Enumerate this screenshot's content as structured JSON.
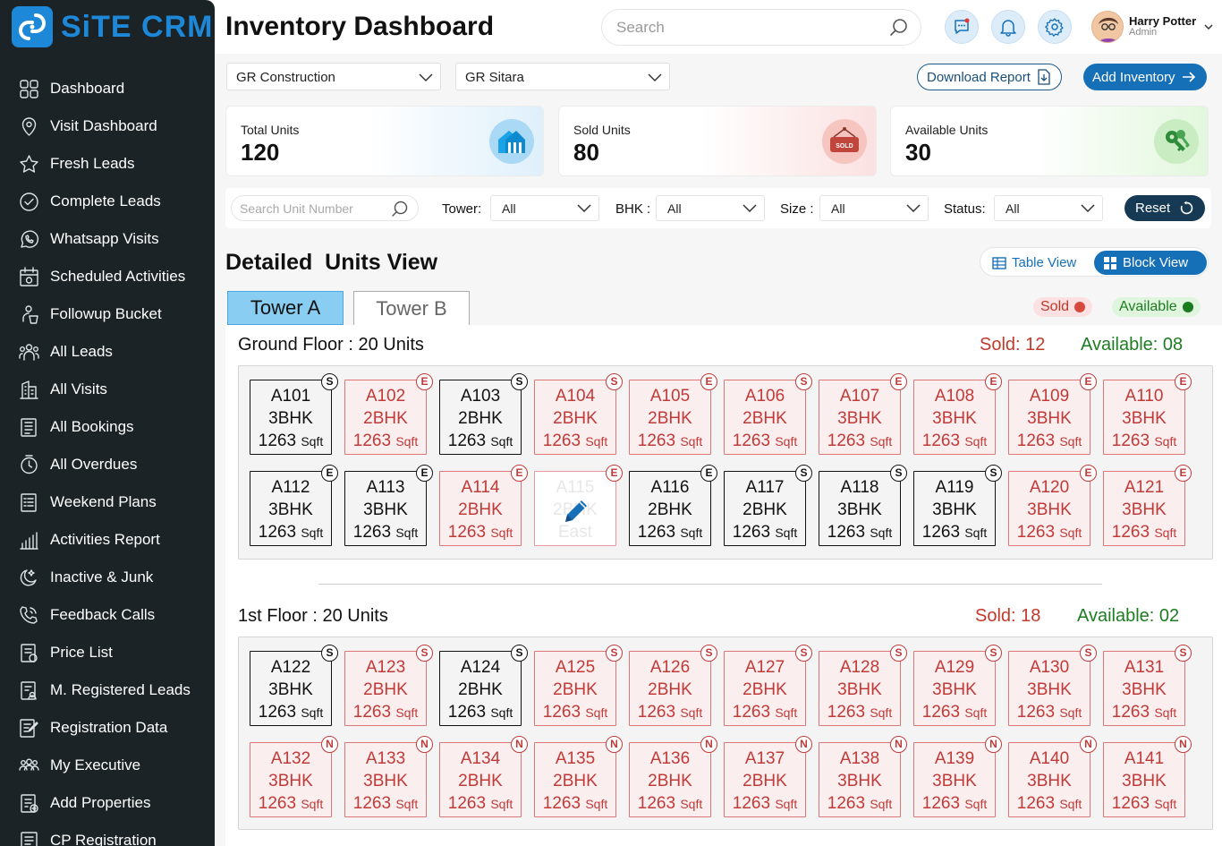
{
  "app": {
    "name": "SiTE CRM"
  },
  "sidebar": {
    "items": [
      {
        "label": "Dashboard",
        "icon": "grid-icon"
      },
      {
        "label": "Visit Dashboard",
        "icon": "location-icon"
      },
      {
        "label": "Fresh Leads",
        "icon": "star-icon"
      },
      {
        "label": "Complete Leads",
        "icon": "check-circle-icon"
      },
      {
        "label": "Whatsapp Visits",
        "icon": "whatsapp-icon"
      },
      {
        "label": "Scheduled Activities",
        "icon": "calendar-icon"
      },
      {
        "label": "Followup Bucket",
        "icon": "bucket-icon"
      },
      {
        "label": "All Leads",
        "icon": "people-icon"
      },
      {
        "label": "All Visits",
        "icon": "building-icon"
      },
      {
        "label": "All Bookings",
        "icon": "book-icon"
      },
      {
        "label": "All Overdues",
        "icon": "clock-icon"
      },
      {
        "label": "Weekend Plans",
        "icon": "list-icon"
      },
      {
        "label": "Activities Report",
        "icon": "bar-chart-icon"
      },
      {
        "label": "Inactive & Junk",
        "icon": "moon-icon"
      },
      {
        "label": "Feedback Calls",
        "icon": "phone-icon"
      },
      {
        "label": "Price List",
        "icon": "price-list-icon"
      },
      {
        "label": "M. Registered Leads",
        "icon": "register-icon"
      },
      {
        "label": "Registration Data",
        "icon": "edit-doc-icon"
      },
      {
        "label": "My Executive",
        "icon": "team-icon"
      },
      {
        "label": "Add Properties",
        "icon": "add-doc-icon"
      },
      {
        "label": "CP Registration",
        "icon": "document-icon"
      }
    ]
  },
  "header": {
    "title": "Inventory Dashboard",
    "search_placeholder": "Search",
    "user": {
      "name": "Harry Potter",
      "role": "Admin"
    }
  },
  "toolbar": {
    "company": "GR Construction",
    "project": "GR Sitara",
    "download_label": "Download Report",
    "add_label": "Add Inventory"
  },
  "stats": {
    "total": {
      "label": "Total Units",
      "value": "120"
    },
    "sold": {
      "label": "Sold Units",
      "value": "80",
      "sign": "SOLD"
    },
    "available": {
      "label": "Available Units",
      "value": "30"
    }
  },
  "filters": {
    "unit_placeholder": "Search Unit Number",
    "tower_label": "Tower:",
    "tower_value": "All",
    "bhk_label": "BHK :",
    "bhk_value": "All",
    "size_label": "Size :",
    "size_value": "All",
    "status_label": "Status:",
    "status_value": "All",
    "reset_label": "Reset"
  },
  "units_view": {
    "title": "Detailed  Units View",
    "table_view_label": "Table View",
    "block_view_label": "Block View"
  },
  "tabs": [
    "Tower A",
    "Tower B"
  ],
  "legend": {
    "sold": "Sold",
    "available": "Available"
  },
  "colors": {
    "sidebar": "#1b2326",
    "brand": "#1e88d8",
    "sold": "#c0392b",
    "available": "#1e7d22"
  },
  "floors": [
    {
      "title": "Ground Floor : 20 Units",
      "sold": "Sold: 12",
      "available": "Available: 08",
      "units": [
        {
          "id": "A101",
          "bhk": "3BHK",
          "size": "1263",
          "unit": "Sqft",
          "badge": "S",
          "status": "available"
        },
        {
          "id": "A102",
          "bhk": "2BHK",
          "size": "1263",
          "unit": "Sqft",
          "badge": "E",
          "status": "sold"
        },
        {
          "id": "A103",
          "bhk": "2BHK",
          "size": "1263",
          "unit": "Sqft",
          "badge": "S",
          "status": "available"
        },
        {
          "id": "A104",
          "bhk": "2BHK",
          "size": "1263",
          "unit": "Sqft",
          "badge": "S",
          "status": "sold"
        },
        {
          "id": "A105",
          "bhk": "2BHK",
          "size": "1263",
          "unit": "Sqft",
          "badge": "E",
          "status": "sold"
        },
        {
          "id": "A106",
          "bhk": "2BHK",
          "size": "1263",
          "unit": "Sqft",
          "badge": "S",
          "status": "sold"
        },
        {
          "id": "A107",
          "bhk": "3BHK",
          "size": "1263",
          "unit": "Sqft",
          "badge": "E",
          "status": "sold"
        },
        {
          "id": "A108",
          "bhk": "3BHK",
          "size": "1263",
          "unit": "Sqft",
          "badge": "E",
          "status": "sold"
        },
        {
          "id": "A109",
          "bhk": "3BHK",
          "size": "1263",
          "unit": "Sqft",
          "badge": "E",
          "status": "sold"
        },
        {
          "id": "A110",
          "bhk": "3BHK",
          "size": "1263",
          "unit": "Sqft",
          "badge": "E",
          "status": "sold"
        },
        {
          "id": "A112",
          "bhk": "3BHK",
          "size": "1263",
          "unit": "Sqft",
          "badge": "E",
          "status": "available"
        },
        {
          "id": "A113",
          "bhk": "3BHK",
          "size": "1263",
          "unit": "Sqft",
          "badge": "E",
          "status": "available"
        },
        {
          "id": "A114",
          "bhk": "2BHK",
          "size": "1263",
          "unit": "Sqft",
          "badge": "E",
          "status": "sold"
        },
        {
          "id": "A115",
          "bhk": "2BHK",
          "size": "East",
          "unit": "",
          "badge": "E",
          "status": "edit"
        },
        {
          "id": "A116",
          "bhk": "2BHK",
          "size": "1263",
          "unit": "Sqft",
          "badge": "E",
          "status": "available"
        },
        {
          "id": "A117",
          "bhk": "2BHK",
          "size": "1263",
          "unit": "Sqft",
          "badge": "S",
          "status": "available"
        },
        {
          "id": "A118",
          "bhk": "3BHK",
          "size": "1263",
          "unit": "Sqft",
          "badge": "S",
          "status": "available"
        },
        {
          "id": "A119",
          "bhk": "3BHK",
          "size": "1263",
          "unit": "Sqft",
          "badge": "S",
          "status": "available"
        },
        {
          "id": "A120",
          "bhk": "3BHK",
          "size": "1263",
          "unit": "Sqft",
          "badge": "E",
          "status": "sold"
        },
        {
          "id": "A121",
          "bhk": "3BHK",
          "size": "1263",
          "unit": "Sqft",
          "badge": "E",
          "status": "sold"
        }
      ]
    },
    {
      "title": "1st Floor : 20 Units",
      "sold": "Sold: 18",
      "available": "Available: 02",
      "units": [
        {
          "id": "A122",
          "bhk": "3BHK",
          "size": "1263",
          "unit": "Sqft",
          "badge": "S",
          "status": "available"
        },
        {
          "id": "A123",
          "bhk": "2BHK",
          "size": "1263",
          "unit": "Sqft",
          "badge": "S",
          "status": "sold"
        },
        {
          "id": "A124",
          "bhk": "2BHK",
          "size": "1263",
          "unit": "Sqft",
          "badge": "S",
          "status": "available"
        },
        {
          "id": "A125",
          "bhk": "2BHK",
          "size": "1263",
          "unit": "Sqft",
          "badge": "S",
          "status": "sold"
        },
        {
          "id": "A126",
          "bhk": "2BHK",
          "size": "1263",
          "unit": "Sqft",
          "badge": "S",
          "status": "sold"
        },
        {
          "id": "A127",
          "bhk": "2BHK",
          "size": "1263",
          "unit": "Sqft",
          "badge": "S",
          "status": "sold"
        },
        {
          "id": "A128",
          "bhk": "3BHK",
          "size": "1263",
          "unit": "Sqft",
          "badge": "S",
          "status": "sold"
        },
        {
          "id": "A129",
          "bhk": "3BHK",
          "size": "1263",
          "unit": "Sqft",
          "badge": "S",
          "status": "sold"
        },
        {
          "id": "A130",
          "bhk": "3BHK",
          "size": "1263",
          "unit": "Sqft",
          "badge": "S",
          "status": "sold"
        },
        {
          "id": "A131",
          "bhk": "3BHK",
          "size": "1263",
          "unit": "Sqft",
          "badge": "S",
          "status": "sold"
        },
        {
          "id": "A132",
          "bhk": "3BHK",
          "size": "1263",
          "unit": "Sqft",
          "badge": "N",
          "status": "sold"
        },
        {
          "id": "A133",
          "bhk": "3BHK",
          "size": "1263",
          "unit": "Sqft",
          "badge": "N",
          "status": "sold"
        },
        {
          "id": "A134",
          "bhk": "2BHK",
          "size": "1263",
          "unit": "Sqft",
          "badge": "N",
          "status": "sold"
        },
        {
          "id": "A135",
          "bhk": "2BHK",
          "size": "1263",
          "unit": "Sqft",
          "badge": "N",
          "status": "sold"
        },
        {
          "id": "A136",
          "bhk": "2BHK",
          "size": "1263",
          "unit": "Sqft",
          "badge": "N",
          "status": "sold"
        },
        {
          "id": "A137",
          "bhk": "2BHK",
          "size": "1263",
          "unit": "Sqft",
          "badge": "N",
          "status": "sold"
        },
        {
          "id": "A138",
          "bhk": "3BHK",
          "size": "1263",
          "unit": "Sqft",
          "badge": "N",
          "status": "sold"
        },
        {
          "id": "A139",
          "bhk": "3BHK",
          "size": "1263",
          "unit": "Sqft",
          "badge": "N",
          "status": "sold"
        },
        {
          "id": "A140",
          "bhk": "3BHK",
          "size": "1263",
          "unit": "Sqft",
          "badge": "N",
          "status": "sold"
        },
        {
          "id": "A141",
          "bhk": "3BHK",
          "size": "1263",
          "unit": "Sqft",
          "badge": "N",
          "status": "sold"
        }
      ]
    }
  ]
}
